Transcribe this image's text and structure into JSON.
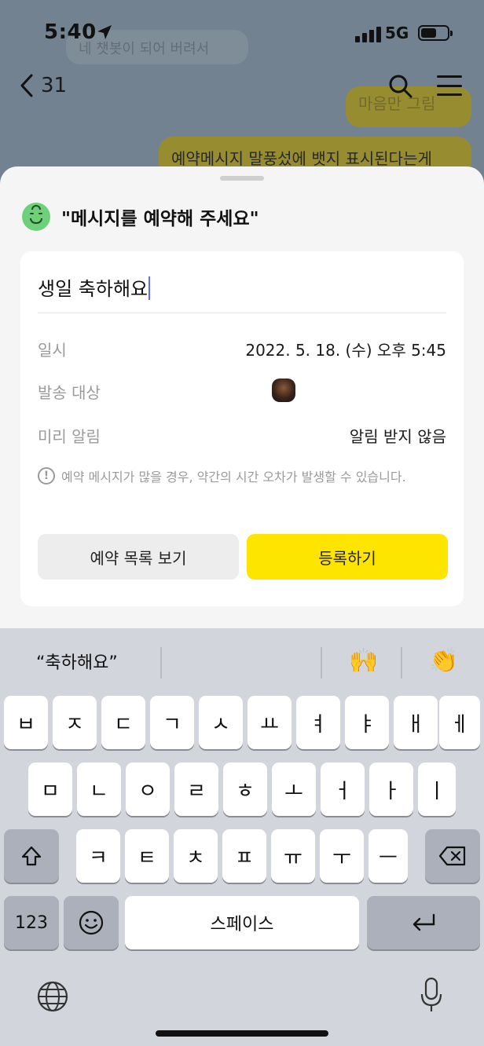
{
  "status_bar": {
    "time": "5:40",
    "network": "5G"
  },
  "chat_header": {
    "back_count": "31"
  },
  "chat_bubbles": {
    "ghost": "네 챗봇이 되어 버려서",
    "yellow_top": "마음만 그림",
    "yellow_bottom": "예약메시지 말풍섰에 뱃지 표시된다는게"
  },
  "sheet": {
    "title": "\"메시지를 예약해 주세요\"",
    "message": "생일 축하해요",
    "rows": [
      {
        "label": "일시",
        "value": "2022. 5. 18. (수) 오후 5:45"
      },
      {
        "label": "발송 대상",
        "value": ""
      },
      {
        "label": "미리 알림",
        "value": "알림 받지 않음"
      }
    ],
    "notice": "예약 메시지가 많을 경우, 약간의 시간 오차가 발생할 수 있습니다.",
    "notice_icon": "!",
    "buttons": {
      "secondary": "예약 목록 보기",
      "primary": "등록하기"
    },
    "colors": {
      "primary": "#fee500"
    }
  },
  "keyboard": {
    "suggestion": "“축하해요”",
    "emoji_1": "🙌",
    "emoji_2": "👏",
    "row1": [
      "ㅂ",
      "ㅈ",
      "ㄷ",
      "ㄱ",
      "ㅅ",
      "ㅛ",
      "ㅕ",
      "ㅑ",
      "ㅐ",
      "ㅔ"
    ],
    "row2": [
      "ㅁ",
      "ㄴ",
      "ㅇ",
      "ㄹ",
      "ㅎ",
      "ㅗ",
      "ㅓ",
      "ㅏ",
      "ㅣ"
    ],
    "row3": [
      "ㅋ",
      "ㅌ",
      "ㅊ",
      "ㅍ",
      "ㅠ",
      "ㅜ",
      "ㅡ"
    ],
    "numbers_key": "123",
    "space_key": "스페이스"
  }
}
